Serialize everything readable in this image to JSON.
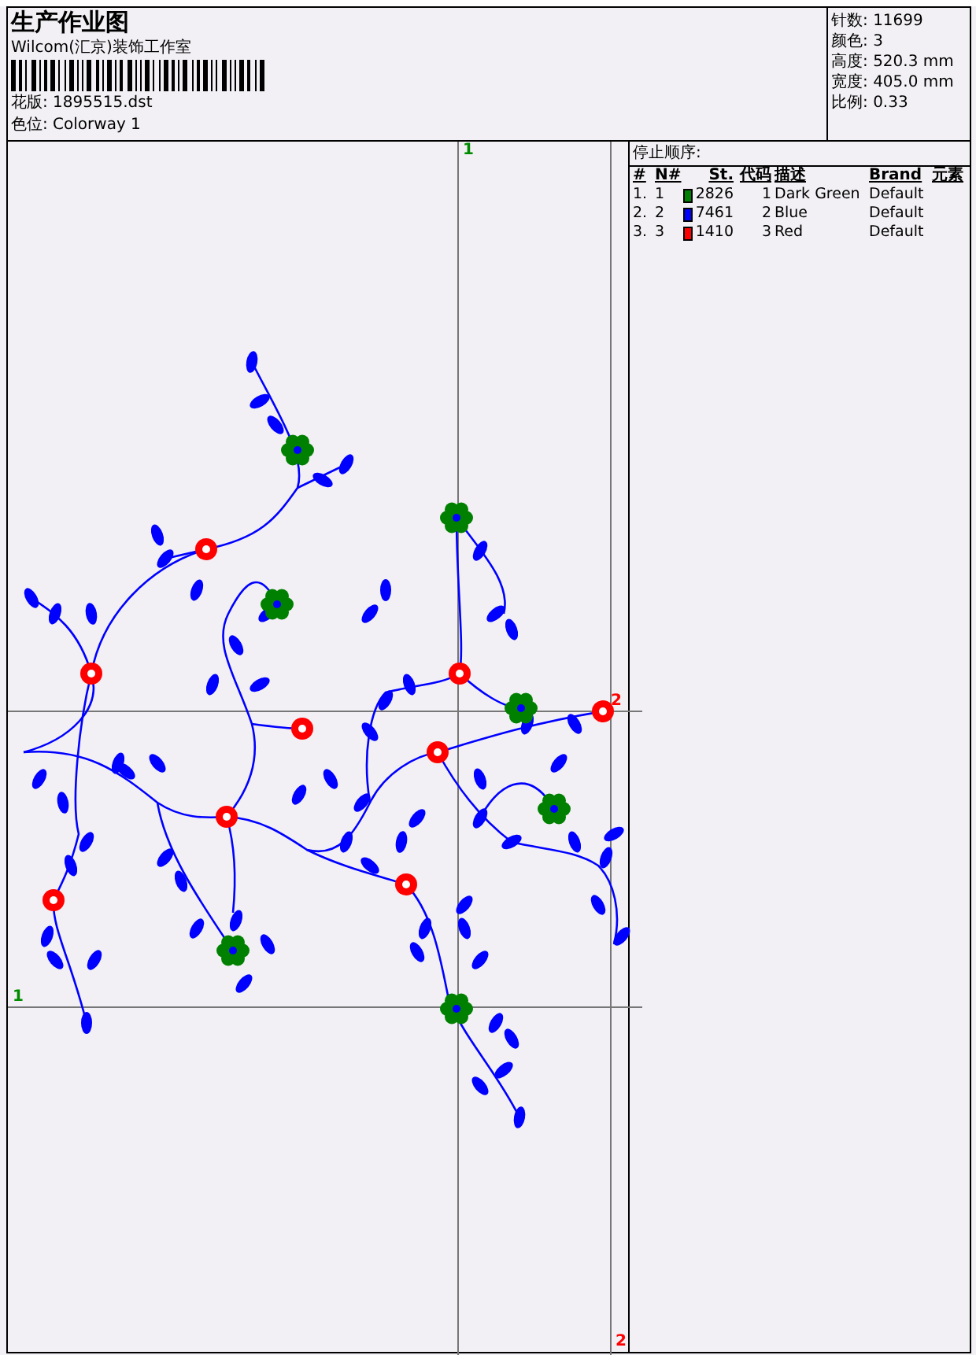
{
  "title": "生产作业图",
  "company": "Wilcom(汇京)装饰工作室",
  "design_file": "花版: 1895515.dst",
  "colorway": "色位: Colorway 1",
  "stats": [
    {
      "label": "针数:",
      "value": "11699"
    },
    {
      "label": "颜色:",
      "value": "3"
    },
    {
      "label": "高度:",
      "value": "520.3 mm"
    },
    {
      "label": "宽度:",
      "value": "405.0 mm"
    },
    {
      "label": "比例:",
      "value": "0.33"
    }
  ],
  "stop_sequence": {
    "title": "停止顺序:",
    "columns": [
      "#",
      "N#",
      "St.",
      "代码",
      "描述",
      "Brand",
      "元素"
    ],
    "rows": [
      {
        "index": "1.",
        "needle": "1",
        "color": "#008000",
        "stitches": "2826",
        "code": "1",
        "description": "Dark Green",
        "brand": "Default"
      },
      {
        "index": "2.",
        "needle": "2",
        "color": "#0000ff",
        "stitches": "7461",
        "code": "2",
        "description": "Blue",
        "brand": "Default"
      },
      {
        "index": "3.",
        "needle": "3",
        "color": "#ff0000",
        "stitches": "1410",
        "code": "3",
        "description": "Red",
        "brand": "Default"
      }
    ]
  },
  "hoop_guides": [
    {
      "kind": "vertical",
      "label": "1",
      "color": "#008a00"
    },
    {
      "kind": "horizontal",
      "label": "2",
      "color": "#ff0000"
    },
    {
      "kind": "horizontal",
      "label": "1",
      "color": "#008a00"
    },
    {
      "kind": "vertical",
      "label": "2",
      "color": "#ff0000"
    }
  ]
}
